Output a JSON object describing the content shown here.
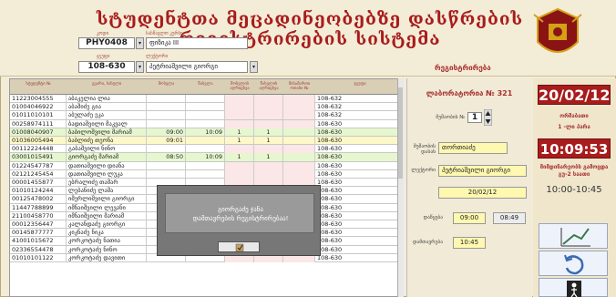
{
  "header": {
    "title": "სტუდენტთა მეცადინეობებზე დასწრების რეგისტრირების სისტემა",
    "course_label": "კოდი",
    "course_name_label": "სასწავლო კურსი",
    "course_code": "PHY0408",
    "course_name": "ფიზიკა III",
    "room_label": "ჯგუფი",
    "lecturer_label": "ლექტორი",
    "room_code": "108-630",
    "lecturer_name": "პეტრიაშვილი გიორგი",
    "registration_label": "რეგისტრირება"
  },
  "table": {
    "columns": [
      "სტუდენტი №",
      "გვარი, სახელი",
      "მოსვლა",
      "წასვლა",
      "მოსვლის აღრიცხვა",
      "წასვლის აღრიცხვა",
      "მისამართი ოთახი №",
      "ჯგუფი"
    ],
    "rows": [
      {
        "id": "11223004555",
        "name": "აბაკელია ლია",
        "t1": "",
        "t2": "",
        "a": "",
        "b": "",
        "c": "",
        "code": "108-632",
        "hl": ""
      },
      {
        "id": "01004046922",
        "name": "აბაშიძე გია",
        "t1": "",
        "t2": "",
        "a": "",
        "b": "",
        "c": "",
        "code": "108-632",
        "hl": ""
      },
      {
        "id": "01011010101",
        "name": "აბულაძე ეკა",
        "t1": "",
        "t2": "",
        "a": "",
        "b": "",
        "c": "",
        "code": "108-632",
        "hl": ""
      },
      {
        "id": "00258974111",
        "name": "ბადიაშვილი მაკვალ",
        "t1": "",
        "t2": "",
        "a": "",
        "b": "",
        "c": "",
        "code": "108-630",
        "hl": ""
      },
      {
        "id": "01008040907",
        "name": "ბაბილოშვილი მარიამ",
        "t1": "09:00",
        "t2": "10:09",
        "a": "1",
        "b": "1",
        "c": "",
        "code": "108-630",
        "hl": "green"
      },
      {
        "id": "01036005494",
        "name": "ბაბლიძე თეონა",
        "t1": "09:01",
        "t2": "",
        "a": "1",
        "b": "1",
        "c": "",
        "code": "108-630",
        "hl": "yellow"
      },
      {
        "id": "00112224448",
        "name": "გაბაშვილი ნინო",
        "t1": "",
        "t2": "",
        "a": "",
        "b": "",
        "c": "",
        "code": "108-630",
        "hl": ""
      },
      {
        "id": "03001015491",
        "name": "გიორგაძე მარიამ",
        "t1": "08:50",
        "t2": "10:09",
        "a": "1",
        "b": "1",
        "c": "",
        "code": "108-630",
        "hl": "green"
      },
      {
        "id": "01224547787",
        "name": "დათიაშვილი დიანა",
        "t1": "",
        "t2": "",
        "a": "",
        "b": "",
        "c": "",
        "code": "108-630",
        "hl": ""
      },
      {
        "id": "02121245454",
        "name": "დათიაშვილი ლუკა",
        "t1": "",
        "t2": "",
        "a": "",
        "b": "",
        "c": "",
        "code": "108-630",
        "hl": ""
      },
      {
        "id": "00001455877",
        "name": "ებრალიძე თამარ",
        "t1": "",
        "t2": "",
        "a": "",
        "b": "",
        "c": "",
        "code": "108-630",
        "hl": ""
      },
      {
        "id": "01010124244",
        "name": "ლებანიძე ლაშა",
        "t1": "",
        "t2": "",
        "a": "",
        "b": "",
        "c": "",
        "code": "108-630",
        "hl": ""
      },
      {
        "id": "00125478002",
        "name": "იმერლიშვილი გიორგი",
        "t1": "",
        "t2": "",
        "a": "",
        "b": "",
        "c": "",
        "code": "108-630",
        "hl": ""
      },
      {
        "id": "11447788899",
        "name": "იმნაიშვილი ლევანი",
        "t1": "",
        "t2": "",
        "a": "",
        "b": "",
        "c": "",
        "code": "108-630",
        "hl": ""
      },
      {
        "id": "21100458770",
        "name": "იმნაიშვილი მარიამ",
        "t1": "",
        "t2": "",
        "a": "",
        "b": "",
        "c": "",
        "code": "108-630",
        "hl": ""
      },
      {
        "id": "00012356447",
        "name": "კალანდაძე გიორგი",
        "t1": "",
        "t2": "",
        "a": "",
        "b": "",
        "c": "",
        "code": "108-630",
        "hl": ""
      },
      {
        "id": "00145877777",
        "name": "კიკნაძე ნიკა",
        "t1": "",
        "t2": "",
        "a": "",
        "b": "",
        "c": "",
        "code": "108-630",
        "hl": ""
      },
      {
        "id": "41001015672",
        "name": "კორკოტაძე ნათია",
        "t1": "",
        "t2": "",
        "a": "",
        "b": "",
        "c": "",
        "code": "108-630",
        "hl": ""
      },
      {
        "id": "02336554478",
        "name": "კორკოტაძე ნინო",
        "t1": "",
        "t2": "",
        "a": "",
        "b": "",
        "c": "",
        "code": "108-630",
        "hl": ""
      },
      {
        "id": "01010101122",
        "name": "კორკოტაძე დავითი",
        "t1": "",
        "t2": "",
        "a": "",
        "b": "",
        "c": "",
        "code": "108-630",
        "hl": ""
      }
    ]
  },
  "panel": {
    "lab_title": "ლაბორატორია № 321",
    "comp_label": "მუშაობის №",
    "comp_number": "1",
    "student_label": "მუშაობის დასახ",
    "student_value": "თორთიაძე",
    "lecturer_label": "ლექტორი",
    "lecturer_value": "პეტრიაშვილი გიორგი",
    "date_value": "20/02/12",
    "start_label": "დაწყება",
    "start_value": "09:00",
    "start_gray": "08:49",
    "end_label": "დამთავრება",
    "end_value": "10:45"
  },
  "right": {
    "date": "20/02/12",
    "weekday": "ორშაბათი",
    "pair": "1 -ლი პარა",
    "time": "10:09:53",
    "building": "მიმდინარეობს გამოცდა",
    "building2": "გუ-2 საათი",
    "slot": "10:00-10:45"
  },
  "dialog": {
    "line1": "გიორგაძე ჯანა",
    "line2": "დამთავრების რეგისტრირებაა!",
    "ok_icon": "ok-icon"
  },
  "colors": {
    "accent": "#a81c1c",
    "highlight_green": "#e6f7cf",
    "highlight_yellow": "#fdf8c8"
  }
}
